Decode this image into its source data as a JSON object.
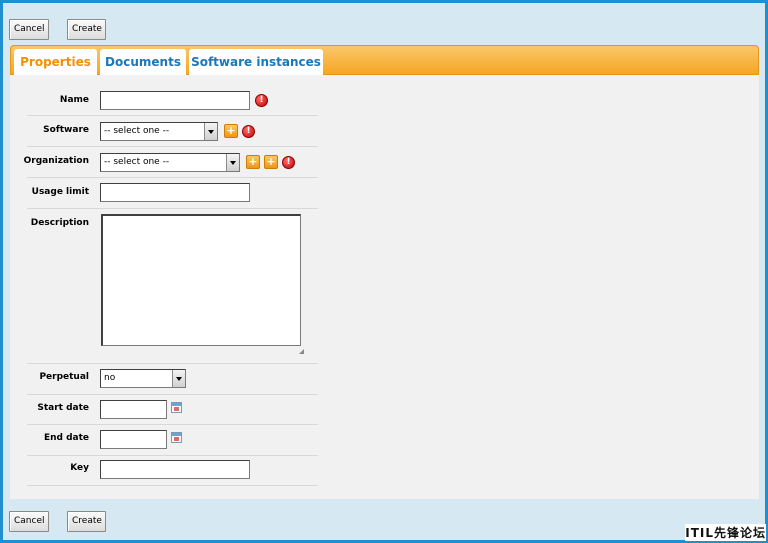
{
  "toolbar": {
    "cancel_label": "Cancel",
    "create_label": "Create"
  },
  "tabs": [
    {
      "label": "Properties",
      "active": true
    },
    {
      "label": "Documents",
      "active": false
    },
    {
      "label": "Software instances",
      "active": false
    }
  ],
  "form": {
    "name": {
      "label": "Name",
      "value": ""
    },
    "software": {
      "label": "Software",
      "value": "-- select one --"
    },
    "organization": {
      "label": "Organization",
      "value": "-- select one --"
    },
    "usage_limit": {
      "label": "Usage limit",
      "value": ""
    },
    "description": {
      "label": "Description",
      "value": ""
    },
    "perpetual": {
      "label": "Perpetual",
      "value": "no"
    },
    "start_date": {
      "label": "Start date",
      "value": ""
    },
    "end_date": {
      "label": "End date",
      "value": ""
    },
    "key": {
      "label": "Key",
      "value": ""
    }
  },
  "icons": {
    "error": "!",
    "add": "+",
    "search": "+"
  },
  "colors": {
    "frame": "#1f8fd0",
    "tab_bar": "#f5a623",
    "tab_active_text": "#f39200",
    "tab_text": "#1a78b8"
  },
  "watermark": "ITIL先锋论坛"
}
